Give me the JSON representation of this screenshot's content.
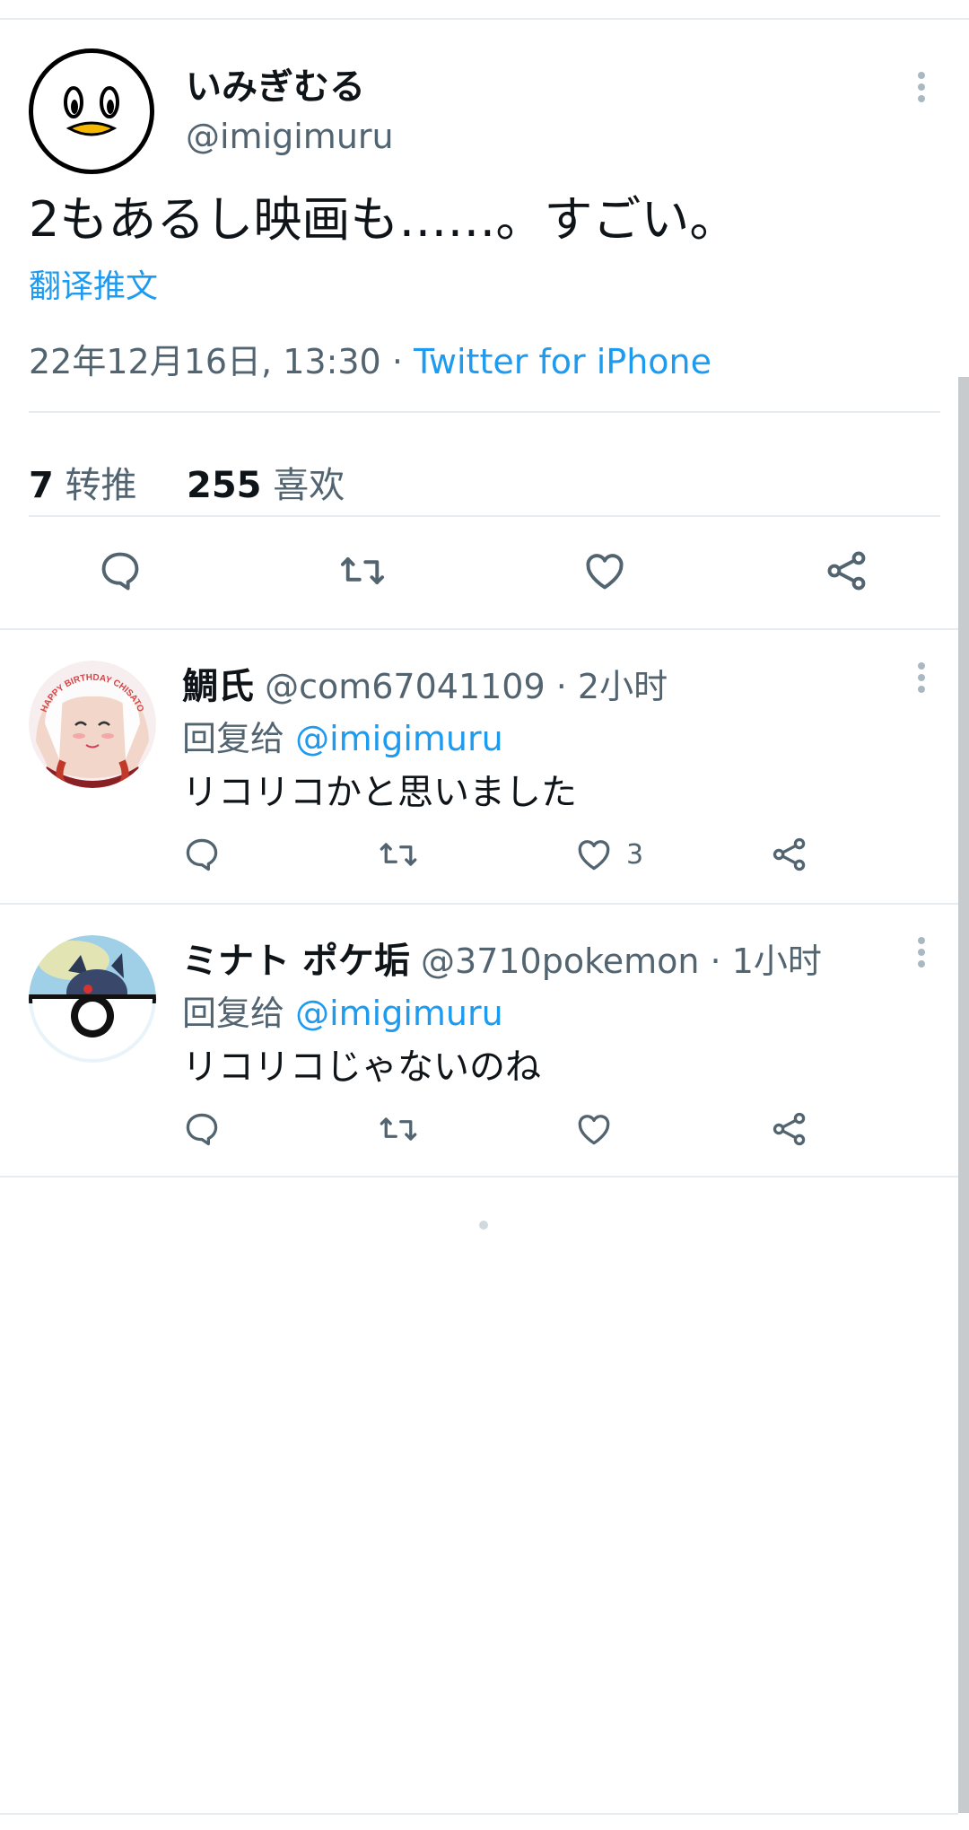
{
  "main_tweet": {
    "display_name": "いみぎむる",
    "handle": "@imigimuru",
    "text": "2もあるし映画も……。すごい。",
    "translate_label": "翻译推文",
    "timestamp": "22年12月16日, 13:30",
    "separator": " · ",
    "source": "Twitter for iPhone",
    "retweet_count": "7",
    "retweet_label": " 转推",
    "like_count": "255",
    "like_label": " 喜欢"
  },
  "replies": [
    {
      "display_name": "鯛氏",
      "meta": " @com67041109 · 2小时",
      "reply_prefix": "回复给 ",
      "mention": "@imigimuru",
      "text": "リコリコかと思いました",
      "like_count": "3",
      "avatar_text": "HAPPY BIRTHDAY CHISATO"
    },
    {
      "display_name": "ミナト ポケ垢",
      "meta": " @3710pokemon · 1小时",
      "reply_prefix": "回复给 ",
      "mention": "@imigimuru",
      "text": "リコリコじゃないのね",
      "like_count": ""
    }
  ],
  "icons": [
    "reply-icon",
    "retweet-icon",
    "like-icon",
    "share-icon",
    "more-icon"
  ],
  "colors": {
    "link": "#1d9bf0",
    "secondary_text": "#536471",
    "divider": "#e6ecf0"
  }
}
